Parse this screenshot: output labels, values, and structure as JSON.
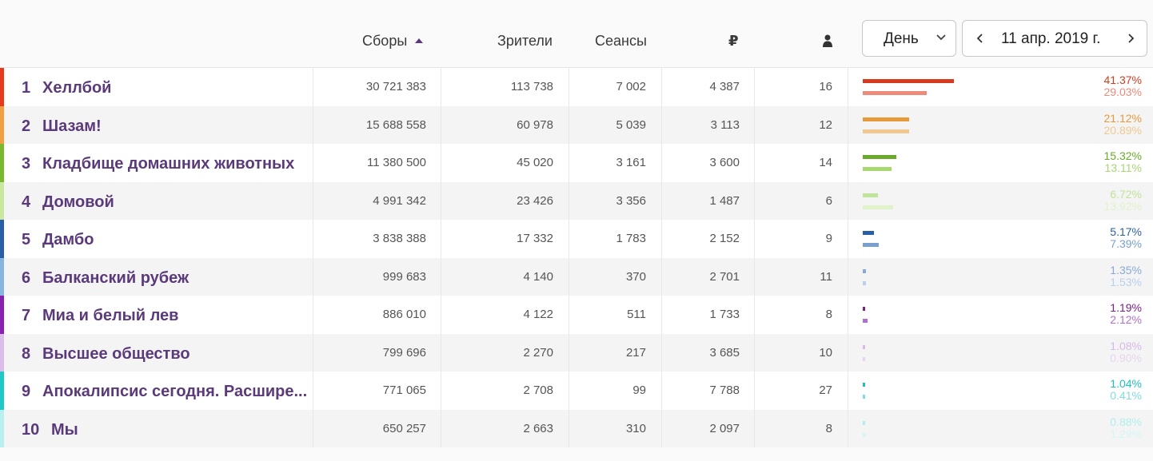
{
  "header": {
    "col_gross": "Сборы",
    "col_viewers": "Зрители",
    "col_sessions": "Сеансы",
    "col_ruble": "₽",
    "period_label": "День",
    "date_label": "11 апр. 2019 г."
  },
  "colors": {
    "accent": "#5b3a7a",
    "row_stripes": [
      "#e63a1e",
      "#f0a040",
      "#7ab830",
      "#c8e8a0",
      "#2a5fa8",
      "#88b4e0",
      "#8a20b0",
      "#dcbce8",
      "#20c8c8",
      "#b8f0f0"
    ]
  },
  "icons": {
    "ruble": "ruble-icon",
    "person": "person-icon",
    "sort": "sort-ascending-icon",
    "chevron_down": "chevron-down-icon",
    "prev": "chevron-left-icon",
    "next": "chevron-right-icon"
  },
  "rows": [
    {
      "rank": "1",
      "title": "Хеллбой",
      "gross": "30 721 383",
      "viewers": "113 738",
      "sessions": "7 002",
      "avg": "4 387",
      "avg_per_session": "16",
      "pct1": "41.37%",
      "pct2": "29.03%",
      "share1": 41.37,
      "share2": 29.03,
      "color1": "#d63b1e",
      "color2": "#ee8a7a"
    },
    {
      "rank": "2",
      "title": "Шазам!",
      "gross": "15 688 558",
      "viewers": "60 978",
      "sessions": "5 039",
      "avg": "3 113",
      "avg_per_session": "12",
      "pct1": "21.12%",
      "pct2": "20.89%",
      "share1": 21.12,
      "share2": 20.89,
      "color1": "#e89a3a",
      "color2": "#f0c890"
    },
    {
      "rank": "3",
      "title": "Кладбище домашних животных",
      "gross": "11 380 500",
      "viewers": "45 020",
      "sessions": "3 161",
      "avg": "3 600",
      "avg_per_session": "14",
      "pct1": "15.32%",
      "pct2": "13.11%",
      "share1": 15.32,
      "share2": 13.11,
      "color1": "#6aaa2a",
      "color2": "#a8d870"
    },
    {
      "rank": "4",
      "title": "Домовой",
      "gross": "4 991 342",
      "viewers": "23 426",
      "sessions": "3 356",
      "avg": "1 487",
      "avg_per_session": "6",
      "pct1": "6.72%",
      "pct2": "13.92%",
      "share1": 6.72,
      "share2": 13.92,
      "color1": "#bfe49a",
      "color2": "#dff2c8"
    },
    {
      "rank": "5",
      "title": "Дамбо",
      "gross": "3 838 388",
      "viewers": "17 332",
      "sessions": "1 783",
      "avg": "2 152",
      "avg_per_session": "9",
      "pct1": "5.17%",
      "pct2": "7.39%",
      "share1": 5.17,
      "share2": 7.39,
      "color1": "#2a5fa8",
      "color2": "#7aa0d0"
    },
    {
      "rank": "6",
      "title": "Балканский рубеж",
      "gross": "999 683",
      "viewers": "4 140",
      "sessions": "370",
      "avg": "2 701",
      "avg_per_session": "11",
      "pct1": "1.35%",
      "pct2": "1.53%",
      "share1": 1.35,
      "share2": 1.53,
      "color1": "#88aad8",
      "color2": "#b8d0ec"
    },
    {
      "rank": "7",
      "title": "Миа и белый лев",
      "gross": "886 010",
      "viewers": "4 122",
      "sessions": "511",
      "avg": "1 733",
      "avg_per_session": "8",
      "pct1": "1.19%",
      "pct2": "2.12%",
      "share1": 1.19,
      "share2": 2.12,
      "color1": "#7a208a",
      "color2": "#b070d0"
    },
    {
      "rank": "8",
      "title": "Высшее общество",
      "gross": "799 696",
      "viewers": "2 270",
      "sessions": "217",
      "avg": "3 685",
      "avg_per_session": "10",
      "pct1": "1.08%",
      "pct2": "0.90%",
      "share1": 1.08,
      "share2": 0.9,
      "color1": "#d8b8e8",
      "color2": "#e8d4f0"
    },
    {
      "rank": "9",
      "title": "Апокалипсис сегодня. Расшире...",
      "gross": "771 065",
      "viewers": "2 708",
      "sessions": "99",
      "avg": "7 788",
      "avg_per_session": "27",
      "pct1": "1.04%",
      "pct2": "0.41%",
      "share1": 1.04,
      "share2": 0.41,
      "color1": "#20c0c0",
      "color2": "#80dede"
    },
    {
      "rank": "10",
      "title": "Мы",
      "gross": "650 257",
      "viewers": "2 663",
      "sessions": "310",
      "avg": "2 097",
      "avg_per_session": "8",
      "pct1": "0.88%",
      "pct2": "1.29%",
      "share1": 0.88,
      "share2": 1.29,
      "color1": "#b0eeee",
      "color2": "#d4f6f6"
    }
  ]
}
